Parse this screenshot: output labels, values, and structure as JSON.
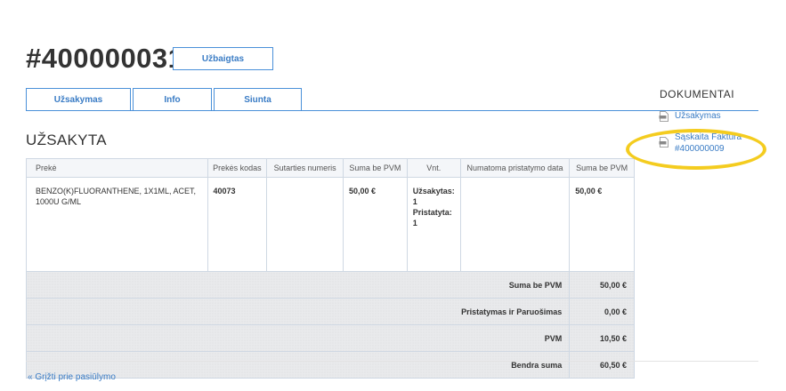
{
  "order": {
    "number": "#400000031",
    "status": "Užbaigtas"
  },
  "tabs": [
    {
      "label": "Užsakymas"
    },
    {
      "label": "Info"
    },
    {
      "label": "Siunta"
    }
  ],
  "section_title": "UŽSAKYTA",
  "table": {
    "headers": [
      "Prekė",
      "Prekės kodas",
      "Sutarties numeris",
      "Suma be PVM",
      "Vnt.",
      "Numatoma pristatymo data",
      "Suma be PVM"
    ],
    "rows": [
      {
        "name": "BENZO(K)FLUORANTHENE, 1X1ML, ACET, 1000U G/ML",
        "code": "40073",
        "contract": "",
        "price": "50,00 €",
        "qty_ordered_label": "Užsakytas:",
        "qty_ordered": "1",
        "qty_delivered_label": "Pristatyta:",
        "qty_delivered": "1",
        "delivery_date": "",
        "total": "50,00 €"
      }
    ],
    "summary": [
      {
        "label": "Suma be PVM",
        "value": "50,00 €"
      },
      {
        "label": "Pristatymas ir Paruošimas",
        "value": "0,00 €"
      },
      {
        "label": "PVM",
        "value": "10,50 €"
      },
      {
        "label": "Bendra suma",
        "value": "60,50 €"
      }
    ]
  },
  "documents": {
    "title": "DOKUMENTAI",
    "items": [
      {
        "label": "Užsakymas",
        "icon": "pdf-icon"
      },
      {
        "label": "Sąskaita Faktūra #400000009",
        "icon": "pdf-icon"
      }
    ]
  },
  "back_link": "« Grįžti prie pasiūlymo",
  "colors": {
    "accent": "#3a7cc5",
    "highlight": "#f4cc1f"
  }
}
